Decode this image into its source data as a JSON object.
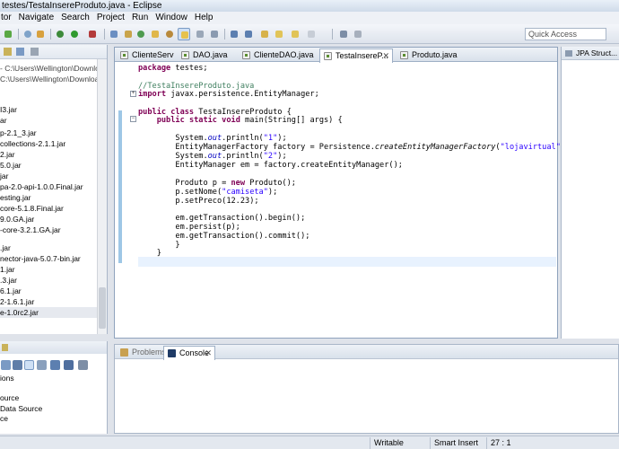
{
  "window": {
    "title": "testes/TestaInsereProduto.java - Eclipse"
  },
  "menu": [
    "tor",
    "Navigate",
    "Search",
    "Project",
    "Run",
    "Window",
    "Help"
  ],
  "quick_access": {
    "placeholder": "Quick Access"
  },
  "left_tree": {
    "items": [
      "- C:\\Users\\Wellington\\Downlo",
      "C:\\Users\\Wellington\\Downloads",
      "I3.jar",
      "ar",
      "p-2.1_3.jar",
      "collections-2.1.1.jar",
      "2.jar",
      "5.0.jar",
      "jar",
      "pa-2.0-api-1.0.0.Final.jar",
      "esting.jar",
      "core-5.1.8.Final.jar",
      "9.0.GA.jar",
      "-core-3.2.1.GA.jar",
      "",
      ".jar",
      "nector-java-5.0.7-bin.jar",
      "1.jar",
      ".3.jar",
      "6.1.jar",
      "2-1.6.1.jar",
      "e-1.0rc2.jar"
    ]
  },
  "editor": {
    "tabs": [
      {
        "label": "ClienteServl...",
        "active": false
      },
      {
        "label": "DAO.java",
        "active": false
      },
      {
        "label": "ClienteDAO.java",
        "active": false
      },
      {
        "label": "TestaInsereP...",
        "active": true
      },
      {
        "label": "Produto.java",
        "active": false
      }
    ],
    "code": {
      "l1": {
        "kw": "package",
        "rest": " testes;"
      },
      "l2": {
        "comment": "//TestaInsereProduto.java"
      },
      "l3": {
        "kw": "import",
        "rest": " javax.persistence.EntityManager;"
      },
      "l4": {
        "kw1": "public",
        "kw2": "class",
        "rest": " TestaInsereProduto {"
      },
      "l5": {
        "kw1": "public",
        "kw2": "static",
        "kw3": "void",
        "rest": " main(String[] args) {"
      },
      "l6": {
        "a": "System.",
        "field": "out",
        "b": ".println(",
        "str": "\"1\"",
        "c": ");"
      },
      "l7": {
        "a": "EntityManagerFactory factory = Persistence.",
        "method": "createEntityManagerFactory",
        "b": "(",
        "str": "\"lojavirtual\"",
        "c": ");"
      },
      "l8": {
        "a": "System.",
        "field": "out",
        "b": ".println(",
        "str": "\"2\"",
        "c": ");"
      },
      "l9": {
        "text": "EntityManager em = factory.createEntityManager();"
      },
      "l10": {
        "a": "Produto p = ",
        "kw": "new",
        "b": " Produto();"
      },
      "l11": {
        "a": "p.setNome(",
        "str": "\"camiseta\"",
        "b": ");"
      },
      "l12": {
        "text": "p.setPreco(12.23);"
      },
      "l13": {
        "text": "em.getTransaction().begin();"
      },
      "l14": {
        "text": "em.persist(p);"
      },
      "l15": {
        "text": "em.getTransaction().commit();"
      },
      "l16": {
        "text": "}"
      },
      "l17": {
        "text": "}"
      }
    }
  },
  "right_panel": {
    "tab_label": "JPA Struct..."
  },
  "bottom_left": {
    "items": [
      "ions",
      "ource",
      "Data Source",
      "ce"
    ]
  },
  "console": {
    "tabs": [
      {
        "label": "Problems",
        "active": false
      },
      {
        "label": "Console",
        "active": true
      }
    ]
  },
  "status": {
    "writable": "Writable",
    "insert_mode": "Smart Insert",
    "position": "27 : 1"
  },
  "colors": {
    "keyword": "#7f0055",
    "comment": "#3f7f5f",
    "string": "#2a00ff",
    "field": "#0000c0"
  }
}
